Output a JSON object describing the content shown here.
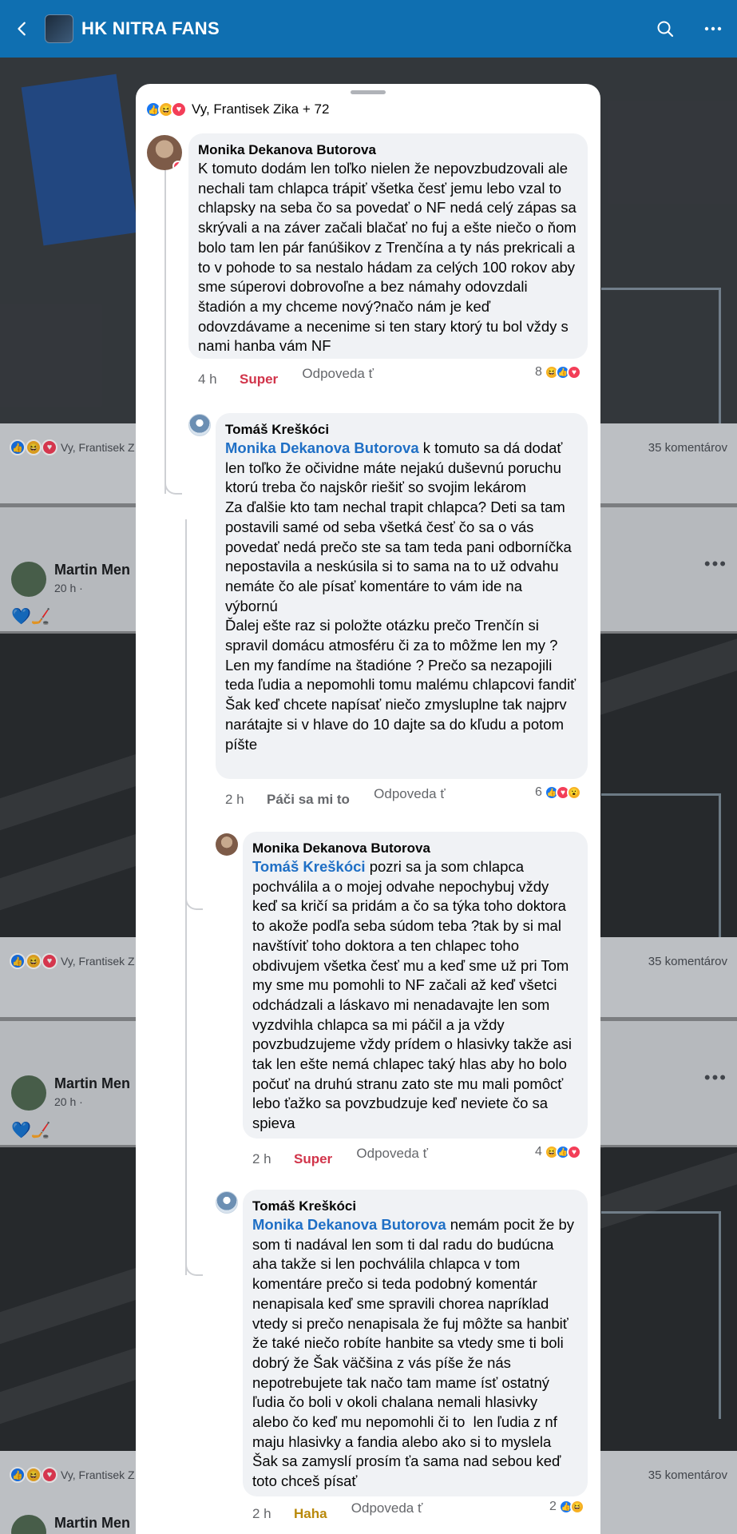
{
  "appbar": {
    "title": "HK NITRA FANS"
  },
  "background": {
    "reactions_text": "Vy, Frantisek Z",
    "comments_count": "35 komentárov",
    "post_author": "Martin Men",
    "post_time": "20 h ·",
    "post_emoji": "💙🏒",
    "more": "•••"
  },
  "sheet": {
    "reactors": "Vy, Frantisek Zika + 72",
    "comments": [
      {
        "author": "Monika Dekanova Butorova",
        "mention": "",
        "text": "K tomuto dodám len toľko nielen že nepovzbudzovali ale nechali tam chlapca trápiť všetka česť jemu lebo vzal to chlapsky na seba čo sa povedať o NF nedá celý zápas sa skrývali a na záver začali blačať no fuj a ešte niečo o ňom bolo tam len pár fanúšikov z Trenčína a ty nás prekricali a to v pohode to sa nestalo hádam za celých 100 rokov aby sme súperovi dobrovoľne a bez námahy odovzdali štadión a my chceme nový?načo nám je keď odovzdávame a necenime si ten stary ktorý tu bol vždy s nami hanba vám NF",
        "time": "4 h",
        "reaction": "Super",
        "reply": "Odpoveda ť",
        "count": "8"
      },
      {
        "author": "Tomáš Kreškóci",
        "mention": "Monika Dekanova Butorova",
        "text": " k tomuto sa dá dodať len toľko že očividne máte nejakú duševnú poruchu ktorú treba čo najskôr riešiť so svojim lekárom\nZa ďalšie kto tam nechal trapit chlapca? Deti sa tam postavili samé od seba všetká česť čo sa o vás povedať nedá prečo ste sa tam teda pani odborníčka nepostavila a neskúsila si to sama na to už odvahu nemáte čo ale písať komentáre to vám ide na výbornú\nĎalej ešte raz si položte otázku prečo Trenčín si spravil domácu atmosféru či za to môžme len my ? Len my fandíme na štadióne ? Prečo sa nezapojili teda ľudia a nepomohli tomu malému chlapcovi fandiť\nŠak keď chcete napísať niečo zmysluplne tak najprv narátajte si v hlave do 10 dajte sa do kľudu a potom píšte",
        "time": "2 h",
        "reaction": "Páči sa mi to",
        "reply": "Odpoveda ť",
        "count": "6"
      },
      {
        "author": "Monika Dekanova Butorova",
        "mention": "Tomáš Kreškóci",
        "text": " pozri sa ja som chlapca pochválila a o mojej odvahe nepochybuj vždy keď sa kričí sa pridám a čo sa týka toho doktora to akože podľa seba súdom teba ?tak by si mal navštíviť toho doktora a ten chlapec toho obdivujem všetka česť mu a keď sme už pri Tom my sme mu pomohli to NF začali až keď všetci odchádzali a láskavo mi nenadavajte len som vyzdvihla chlapca sa mi páčil a ja vždy povzbudzujeme vždy prídem o hlasivky takže asi tak len ešte nemá chlapec taký hlas aby ho bolo počuť na druhú stranu zato ste mu mali pomôcť lebo ťažko sa povzbudzuje keď neviete čo sa spieva",
        "time": "2 h",
        "reaction": "Super",
        "reply": "Odpoveda ť",
        "count": "4"
      },
      {
        "author": "Tomáš Kreškóci",
        "mention": "Monika Dekanova Butorova",
        "text": " nemám pocit že by som ti nadával len som ti dal radu do budúcna aha takže si len pochválila chlapca v tom komentáre prečo si teda podobný komentár nenapisala keď sme spravili chorea napríklad vtedy si prečo nenapisala že fuj môžte sa hanbiť že také niečo robíte hanbite sa vtedy sme ti boli dobrý že Šak väčšina z vás píše že nás nepotrebujete tak načo tam mame ísť ostatný ľudia čo boli v okoli chalana nemali hlasivky alebo čo keď mu nepomohli či to  len ľudia z nf maju hlasivky a fandia alebo ako si to myslela Šak sa zamyslí prosím ťa sama nad sebou keď toto chceš písať",
        "time": "2 h",
        "reaction": "Haha",
        "reply": "Odpoveda ť",
        "count": "2"
      }
    ]
  }
}
